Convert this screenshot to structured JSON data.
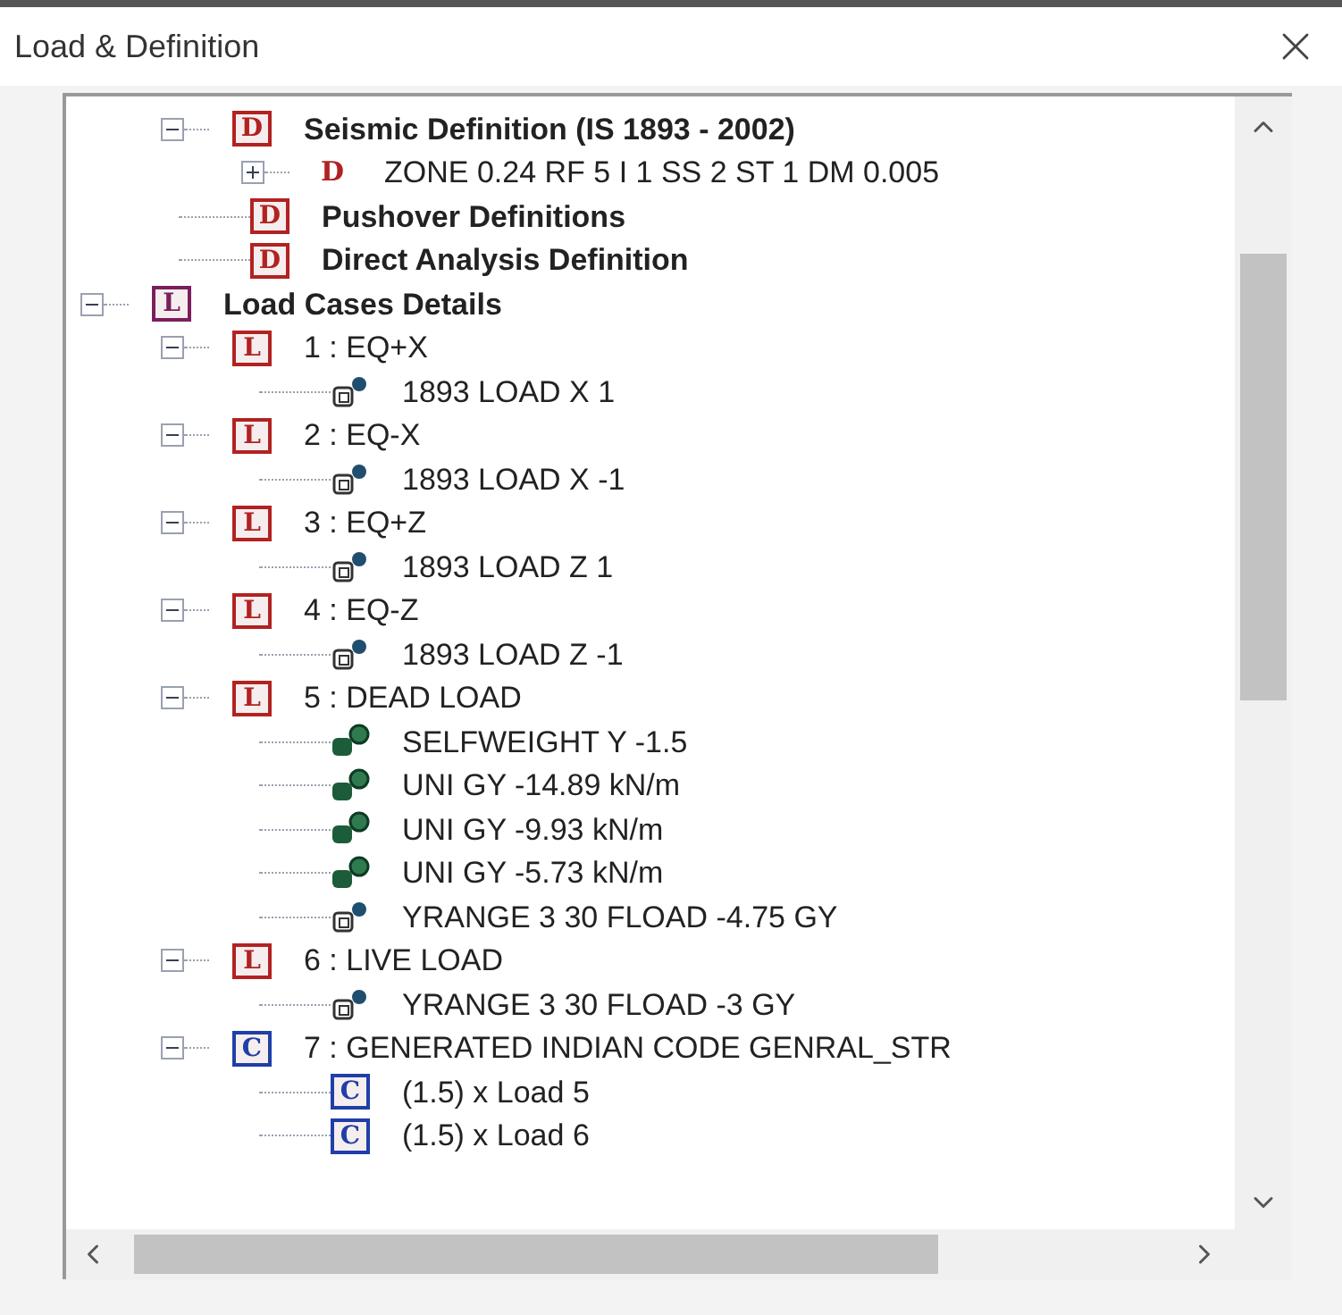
{
  "window": {
    "title": "Load & Definition"
  },
  "tree": {
    "definitions": [
      {
        "label": "Seismic Definition (IS 1893 - 2002)",
        "kind": "boxed",
        "letter": "D",
        "color": "#b22222",
        "bold": true,
        "expanded": true,
        "children": [
          {
            "label": "ZONE 0.24 RF 5 I 1 SS 2 ST 1 DM 0.005",
            "kind": "plain",
            "letter": "D",
            "color": "#b22222",
            "bold": false,
            "expanded": false
          }
        ]
      },
      {
        "label": "Pushover Definitions",
        "kind": "boxed",
        "letter": "D",
        "color": "#b22222",
        "bold": true
      },
      {
        "label": "Direct Analysis Definition",
        "kind": "boxed",
        "letter": "D",
        "color": "#b22222",
        "bold": true
      }
    ],
    "roots": [
      {
        "label": "Load Cases Details",
        "kind": "boxed",
        "letter": "L",
        "color": "#7a1f5c",
        "bold": true,
        "expanded": true,
        "children": [
          {
            "label": "1 : EQ+X",
            "kind": "boxed",
            "letter": "L",
            "color": "#b22222",
            "bold": false,
            "expanded": true,
            "children": [
              {
                "label": "1893 LOAD X 1",
                "kind": "outline",
                "bold": false
              }
            ]
          },
          {
            "label": "2 : EQ-X",
            "kind": "boxed",
            "letter": "L",
            "color": "#b22222",
            "bold": false,
            "expanded": true,
            "children": [
              {
                "label": "1893 LOAD X -1",
                "kind": "outline",
                "bold": false
              }
            ]
          },
          {
            "label": "3 : EQ+Z",
            "kind": "boxed",
            "letter": "L",
            "color": "#b22222",
            "bold": false,
            "expanded": true,
            "children": [
              {
                "label": "1893 LOAD Z 1",
                "kind": "outline",
                "bold": false
              }
            ]
          },
          {
            "label": "4 : EQ-Z",
            "kind": "boxed",
            "letter": "L",
            "color": "#b22222",
            "bold": false,
            "expanded": true,
            "children": [
              {
                "label": "1893 LOAD Z -1",
                "kind": "outline",
                "bold": false
              }
            ]
          },
          {
            "label": "5 : DEAD LOAD",
            "kind": "boxed",
            "letter": "L",
            "color": "#b22222",
            "bold": false,
            "expanded": true,
            "children": [
              {
                "label": "SELFWEIGHT Y -1.5",
                "kind": "solid",
                "bold": false
              },
              {
                "label": "UNI GY -14.89 kN/m",
                "kind": "solid",
                "bold": false
              },
              {
                "label": "UNI GY -9.93 kN/m",
                "kind": "solid",
                "bold": false
              },
              {
                "label": "UNI GY -5.73 kN/m",
                "kind": "solid",
                "bold": false
              },
              {
                "label": "YRANGE 3 30 FLOAD -4.75 GY",
                "kind": "outline",
                "bold": false
              }
            ]
          },
          {
            "label": "6 : LIVE LOAD",
            "kind": "boxed",
            "letter": "L",
            "color": "#b22222",
            "bold": false,
            "expanded": true,
            "children": [
              {
                "label": "YRANGE 3 30 FLOAD -3 GY",
                "kind": "outline",
                "bold": false
              }
            ]
          },
          {
            "label": "7 : GENERATED INDIAN CODE GENRAL_STR",
            "kind": "boxed",
            "letter": "C",
            "color": "#1f3fa8",
            "bold": false,
            "expanded": true,
            "children": [
              {
                "label": "(1.5) x Load 5",
                "kind": "boxed",
                "letter": "C",
                "color": "#1f3fa8",
                "bold": false
              },
              {
                "label": "(1.5) x Load 6",
                "kind": "boxed",
                "letter": "C",
                "color": "#1f3fa8",
                "bold": false
              }
            ]
          }
        ]
      }
    ]
  }
}
